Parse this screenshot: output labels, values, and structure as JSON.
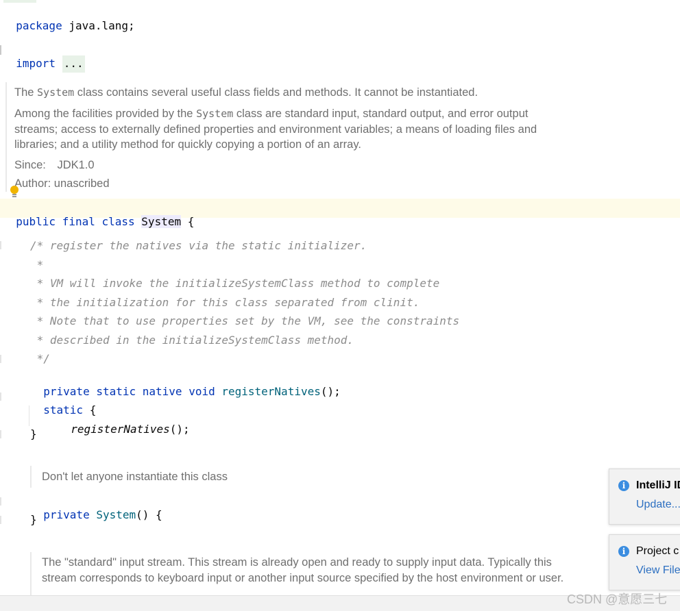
{
  "editor": {
    "package_kw": "package",
    "package_name": "java.lang;",
    "import_kw": "import",
    "import_folded": "...",
    "class_doc": {
      "line1_pre": "The ",
      "line1_code": "System",
      "line1_post": " class contains several useful class fields and methods. It cannot be instantiated.",
      "para2_pre": "Among the facilities provided by the ",
      "para2_code": "System",
      "para2_post": " class are standard input, standard output, and error output streams; access to externally defined properties and environment variables; a means of loading files and libraries; and a utility method for quickly copying a portion of an array.",
      "since_label": "Since:",
      "since_value": "JDK1.0",
      "author_label": "Author:",
      "author_value": "unascribed"
    },
    "class_decl": {
      "mods": "public final class",
      "name": "System",
      "brace": "{"
    },
    "comment_lines": [
      "/* register the natives via the static initializer.",
      " *",
      " * VM will invoke the initializeSystemClass method to complete",
      " * the initialization for this class separated from clinit.",
      " * Note that to use properties set by the VM, see the constraints",
      " * described in the initializeSystemClass method.",
      " */"
    ],
    "native_decl": {
      "mods": "private static native void",
      "name": "registerNatives",
      "rest": "();"
    },
    "static_block": {
      "kw": "static",
      "open": "{",
      "call": "registerNatives",
      "call_rest": "();",
      "close": "}"
    },
    "ctor_doc": "Don't let anyone instantiate this class",
    "ctor_decl": {
      "mods": "private",
      "name": "System",
      "rest": "() {",
      "close": "}"
    },
    "in_doc": "The \"standard\" input stream. This stream is already open and ready to supply input data. Typically this stream corresponds to keyboard input or another input source specified by the host environment or user."
  },
  "notifications": [
    {
      "title": "IntelliJ ID",
      "link": "Update..."
    },
    {
      "title": "Project c",
      "link": "View File"
    }
  ],
  "watermark": "CSDN @意愿三七",
  "colors": {
    "keyword": "#0033b3",
    "function": "#00627a",
    "comment": "#8c8c8c",
    "doc_text": "#6f6f6f",
    "caret_row": "#fefbe8",
    "fold_bg": "#e8f2e8",
    "bulb": "#f0b400",
    "info": "#3b8de0",
    "link": "#2c6fc1"
  }
}
